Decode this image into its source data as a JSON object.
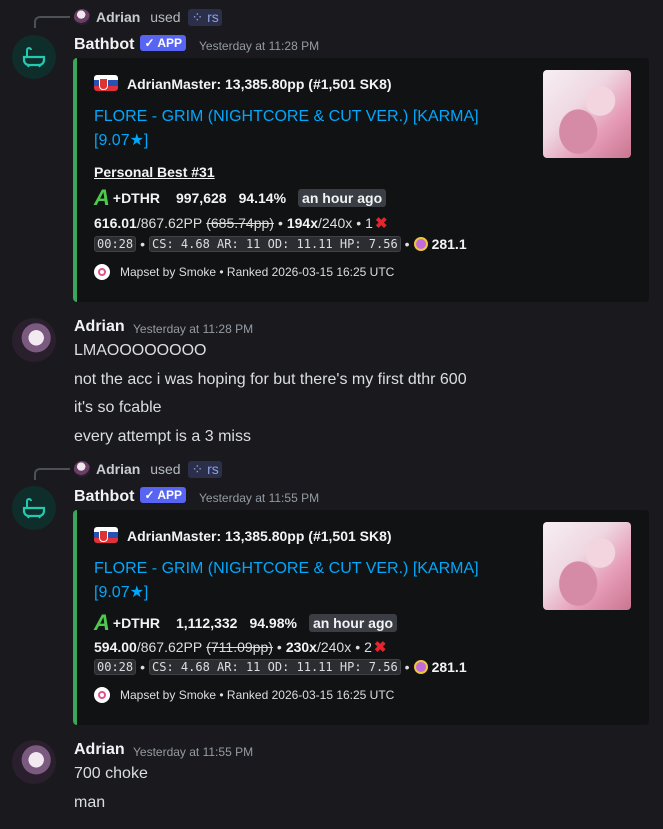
{
  "messages": [
    {
      "reply": {
        "user": "Adrian",
        "used": "used",
        "command": "rs"
      },
      "author": "Bathbot",
      "badge": "APP",
      "time": "Yesterday at 11:28 PM",
      "embed": {
        "author": "AdrianMaster: 13,385.80pp (#1,501 SK8)",
        "title": "FLORE - GRIM (NIGHTCORE & CUT VER.) [KARMA] [9.07★]",
        "field_name": "Personal Best #31",
        "grade": "A",
        "mods": "+DTHR",
        "score": "997,628",
        "accuracy": "94.14%",
        "ago": "an hour ago",
        "pp": "616.01",
        "pp_max": "/867.62PP",
        "pp_fc": "(685.74pp)",
        "combo": "194x",
        "combo_max": "/240x",
        "misses": "1",
        "length": "00:28",
        "stats": "CS: 4.68 AR: 11 OD: 11.11 HP: 7.56",
        "bpm": "281.1",
        "footer": "Mapset by Smoke • Ranked 2026-03-15 16:25 UTC"
      }
    },
    {
      "author": "Adrian",
      "time": "Yesterday at 11:28 PM",
      "lines": [
        "LMAOOOOOOOO",
        "not the acc i was hoping for but there's my first dthr 600",
        "it's so fcable",
        "every attempt is a 3 miss"
      ]
    },
    {
      "reply": {
        "user": "Adrian",
        "used": "used",
        "command": "rs"
      },
      "author": "Bathbot",
      "badge": "APP",
      "time": "Yesterday at 11:55 PM",
      "embed": {
        "author": "AdrianMaster: 13,385.80pp (#1,501 SK8)",
        "title": "FLORE - GRIM (NIGHTCORE & CUT VER.) [KARMA] [9.07★]",
        "grade": "A",
        "mods": "+DTHR",
        "score": "1,112,332",
        "accuracy": "94.98%",
        "ago": "an hour ago",
        "pp": "594.00",
        "pp_max": "/867.62PP",
        "pp_fc": "(711.09pp)",
        "combo": "230x",
        "combo_max": "/240x",
        "misses": "2",
        "length": "00:28",
        "stats": "CS: 4.68 AR: 11 OD: 11.11 HP: 7.56",
        "bpm": "281.1",
        "footer": "Mapset by Smoke • Ranked 2026-03-15 16:25 UTC"
      }
    },
    {
      "author": "Adrian",
      "time": "Yesterday at 11:55 PM",
      "lines": [
        "700 choke",
        "man"
      ]
    }
  ],
  "colors": {
    "accent": "#3ba55c",
    "link": "#00a8fc",
    "badge": "#5865f2"
  }
}
